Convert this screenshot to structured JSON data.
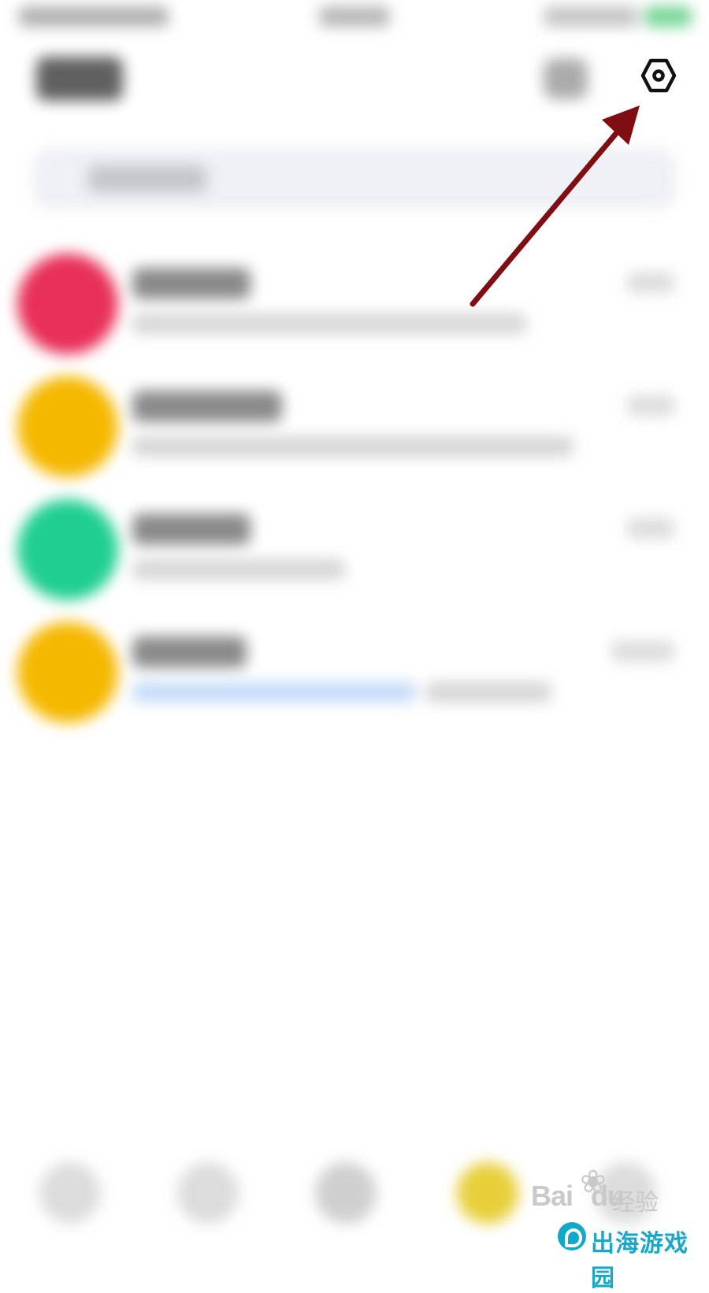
{
  "status_bar": {},
  "header": {
    "settings_icon": "hexagon-settings-icon"
  },
  "search": {},
  "conversations": [
    {
      "avatar_color": "#e8305a"
    },
    {
      "avatar_color": "#f5b800"
    },
    {
      "avatar_color": "#1fcf8f"
    },
    {
      "avatar_color": "#f5b800",
      "preview_has_link": true
    }
  ],
  "tab_bar": {
    "tabs": [
      {
        "color": "#dcdcdc"
      },
      {
        "color": "#dcdcdc"
      },
      {
        "color": "#cfcfcf"
      },
      {
        "color": "#e8cf3a"
      },
      {
        "color": "#dcdcdc"
      }
    ]
  },
  "annotation": {
    "arrow_color": "#7f0d12"
  },
  "watermarks": {
    "baidu_brand": "Bai",
    "baidu_brand_tail": "du",
    "baidu_label": "经验",
    "game_site": "出海游戏园"
  }
}
